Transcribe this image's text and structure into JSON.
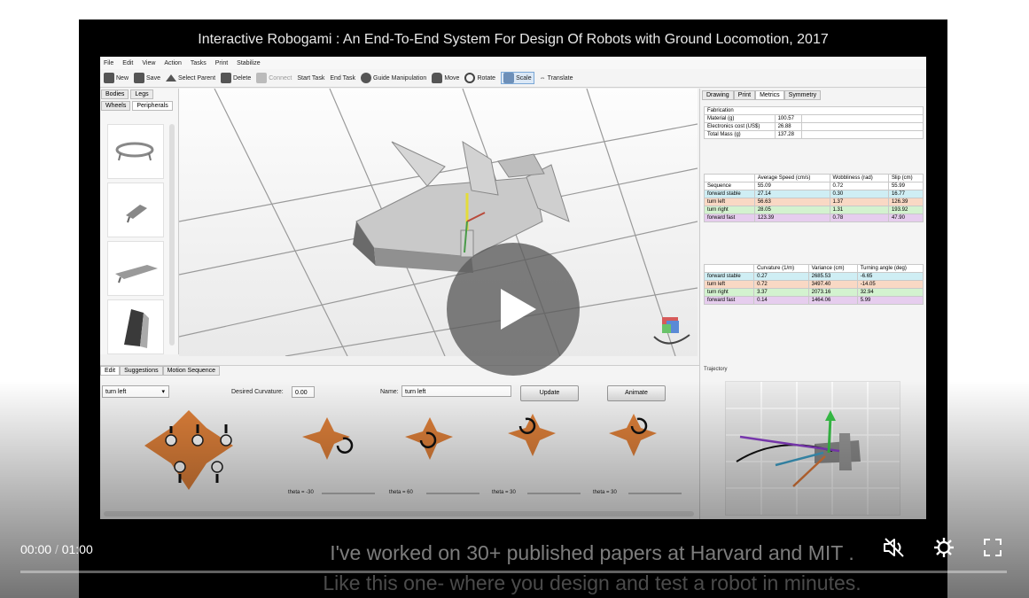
{
  "video": {
    "title": "Interactive Robogami : An End-To-End System For Design Of Robots with Ground Locomotion, 2017",
    "captions": [
      "I've worked on 30+ published papers at Harvard and MIT .",
      "Like this one- where you design and test a robot in minutes."
    ]
  },
  "app": {
    "menu": [
      "File",
      "Edit",
      "View",
      "Action",
      "Tasks",
      "Print",
      "Stabilize"
    ],
    "toolbar": [
      {
        "label": "New",
        "icon": "new-icon"
      },
      {
        "label": "Save",
        "icon": "save-icon"
      },
      {
        "label": "Select Parent",
        "icon": "select-parent-icon"
      },
      {
        "label": "Delete",
        "icon": "trash-icon"
      },
      {
        "label": "Connect",
        "icon": "connect-icon"
      },
      {
        "label": "Start Task",
        "icon": ""
      },
      {
        "label": "End Task",
        "icon": ""
      },
      {
        "label": "Guide Manipulation",
        "icon": "guide-icon"
      },
      {
        "label": "Move",
        "icon": "hand-icon"
      },
      {
        "label": "Rotate",
        "icon": "rotate-icon"
      },
      {
        "label": "Scale",
        "icon": "scale-icon"
      },
      {
        "label": "Translate",
        "icon": "translate-icon"
      }
    ],
    "parts_tabs": [
      "Bodies",
      "Legs",
      "Wheels",
      "Peripherals"
    ],
    "right_tabs": [
      "Drawing",
      "Print",
      "Metrics",
      "Symmetry"
    ],
    "fabrication": {
      "header": "Fabrication",
      "rows": [
        [
          "Material (g)",
          "100.57"
        ],
        [
          "Electronics cost (US$)",
          "26.88"
        ],
        [
          "Total Mass (g)",
          "137.28"
        ]
      ]
    },
    "gait_table": {
      "headers": [
        "",
        "Average Speed (cm/s)",
        "Wobbliness (rad)",
        "Slip (cm)"
      ],
      "rows": [
        [
          "Sequence",
          "55.09",
          "0.72",
          "55.99"
        ],
        [
          "forward stable",
          "27.14",
          "0.30",
          "16.77"
        ],
        [
          "turn left",
          "56.63",
          "1.37",
          "126.39"
        ],
        [
          "turn right",
          "28.05",
          "1.31",
          "193.92"
        ],
        [
          "forward fast",
          "123.39",
          "0.78",
          "47.90"
        ]
      ],
      "row_colors": [
        "#ffffff",
        "#cfeef4",
        "#f9d8c4",
        "#d3f2cf",
        "#e6cdee"
      ]
    },
    "curv_table": {
      "headers": [
        "",
        "Curvature (1/m)",
        "Variance (cm)",
        "Turning angle (deg)"
      ],
      "rows": [
        [
          "forward stable",
          "0.27",
          "2685.53",
          "-6.65"
        ],
        [
          "turn left",
          "0.72",
          "3497.40",
          "-14.05"
        ],
        [
          "turn right",
          "3.37",
          "2073.16",
          "32.94"
        ],
        [
          "forward fast",
          "0.14",
          "1464.06",
          "5.99"
        ]
      ],
      "row_colors": [
        "#cfeef4",
        "#f9d8c4",
        "#d3f2cf",
        "#e6cdee"
      ]
    },
    "trajectory_label": "Trajectory",
    "bottom_tabs": [
      "Edit",
      "Suggestions",
      "Motion Sequence"
    ],
    "gait_select": "turn left",
    "desired_curvature_label": "Desired Curvature:",
    "desired_curvature_value": "0.00",
    "name_label": "Name:",
    "name_value": "turn left",
    "update_label": "Update",
    "animate_label": "Animate",
    "thetas": [
      "theta = -30",
      "theta = 60",
      "theta = 30",
      "theta = 30"
    ],
    "orange": "#e0813a"
  },
  "controls": {
    "time_current": "00:00",
    "time_sep": "/",
    "time_total": "01:00",
    "progress": 0
  }
}
